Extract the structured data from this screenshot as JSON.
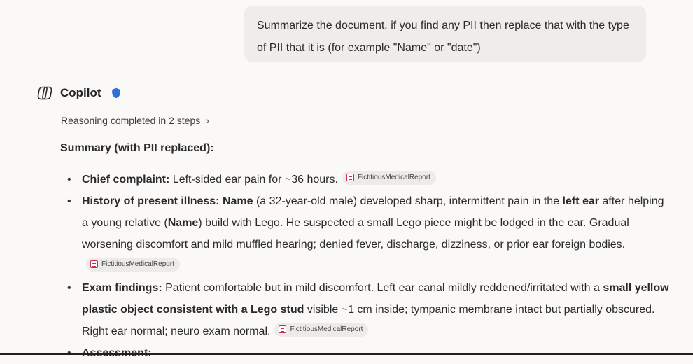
{
  "user_message": {
    "text": "Summarize the document. if you find any PII then replace that with the type of PII that it is (for example \"Name\" or \"date\")"
  },
  "assistant": {
    "name": "Copilot",
    "reasoning": {
      "label": "Reasoning completed in 2 steps",
      "chevron": "›"
    },
    "summary_heading": "Summary (with PII replaced):",
    "citation_label": "FictitiousMedicalReport",
    "bullets": [
      {
        "label": "Chief complaint:",
        "text": " Left-sided ear pain for ~36 hours."
      },
      {
        "label": "History of present illness:",
        "name1": "Name",
        "t1": " (a 32-year-old male) developed sharp, intermittent pain in the ",
        "bold1": "left ear",
        "t2": " after helping a young relative (",
        "name2": "Name",
        "t3": ") build with Lego. He suspected a small Lego piece might be lodged in the ear. Gradual worsening discomfort and mild muffled hearing; denied fever, discharge, dizziness, or prior ear foreign bodies."
      },
      {
        "label": "Exam findings:",
        "t1": " Patient comfortable but in mild discomfort. Left ear canal mildly reddened/irritated with a ",
        "bold1": "small yellow plastic object consistent with a Lego stud",
        "t2": " visible ~1 cm inside; tympanic membrane intact but partially obscured. Right ear normal; neuro exam normal."
      },
      {
        "label": "Assessment:"
      }
    ]
  },
  "icons": {
    "logo": "copilot-logo-icon",
    "shield": "shield-icon",
    "citation": "pdf-file-icon"
  },
  "colors": {
    "background": "#faf9f8",
    "user_bubble": "#efedea",
    "shield": "#2f6fd6",
    "citation_chip": "#ecebe9",
    "pdf_red": "#c4314b"
  }
}
